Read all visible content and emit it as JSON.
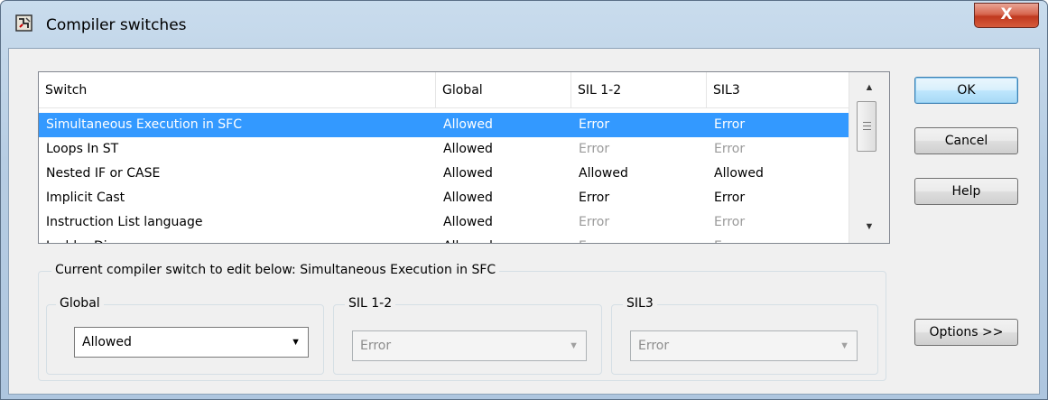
{
  "window": {
    "title": "Compiler switches",
    "close_label": "X"
  },
  "list": {
    "columns": [
      "Switch",
      "Global",
      "SIL 1-2",
      "SIL3"
    ],
    "rows": [
      {
        "switch": "Simultaneous Execution in SFC",
        "global": "Allowed",
        "sil12": "Error",
        "sil3": "Error",
        "selected": true,
        "dim": false
      },
      {
        "switch": "Loops In ST",
        "global": "Allowed",
        "sil12": "Error",
        "sil3": "Error",
        "selected": false,
        "dim": true
      },
      {
        "switch": "Nested IF or CASE",
        "global": "Allowed",
        "sil12": "Allowed",
        "sil3": "Allowed",
        "selected": false,
        "dim": false
      },
      {
        "switch": "Implicit Cast",
        "global": "Allowed",
        "sil12": "Error",
        "sil3": "Error",
        "selected": false,
        "dim": false
      },
      {
        "switch": "Instruction List language",
        "global": "Allowed",
        "sil12": "Error",
        "sil3": "Error",
        "selected": false,
        "dim": true
      },
      {
        "switch": "Ladder Diagram",
        "global": "Allowed",
        "sil12": "Error",
        "sil3": "Error",
        "selected": false,
        "dim": true
      }
    ]
  },
  "buttons": {
    "ok": "OK",
    "cancel": "Cancel",
    "help": "Help",
    "options": "Options >>"
  },
  "editor": {
    "label": "Current compiler switch to edit below: Simultaneous Execution in SFC",
    "global": {
      "label": "Global",
      "value": "Allowed"
    },
    "sil12": {
      "label": "SIL 1-2",
      "value": "Error"
    },
    "sil3": {
      "label": "SIL3",
      "value": "Error"
    }
  },
  "colors": {
    "selection": "#3399ff",
    "dim_text": "#9a9a9a"
  }
}
